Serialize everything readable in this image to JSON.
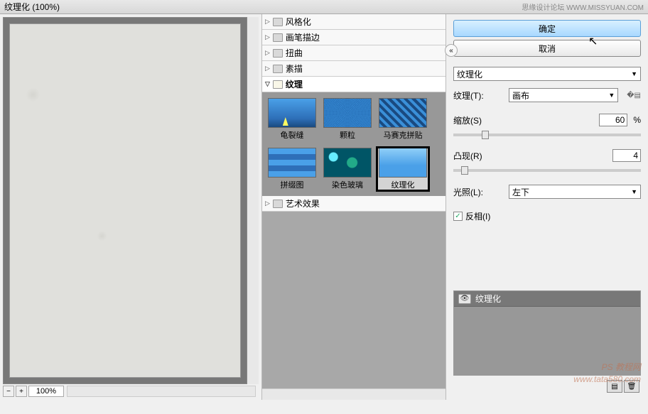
{
  "title": "纹理化 (100%)",
  "titlebar_right": "思缘设计论坛  WWW.MISSYUAN.COM",
  "zoom": "100%",
  "categories": [
    {
      "label": "风格化",
      "expanded": false
    },
    {
      "label": "画笔描边",
      "expanded": false
    },
    {
      "label": "扭曲",
      "expanded": false
    },
    {
      "label": "素描",
      "expanded": false
    },
    {
      "label": "纹理",
      "expanded": true
    },
    {
      "label": "艺术效果",
      "expanded": false
    }
  ],
  "thumbs": [
    {
      "label": "龟裂缝",
      "cls": "t-sky"
    },
    {
      "label": "颗粒",
      "cls": "t-grain"
    },
    {
      "label": "马赛克拼贴",
      "cls": "t-mosaic"
    },
    {
      "label": "拼缀图",
      "cls": "t-patch"
    },
    {
      "label": "染色玻璃",
      "cls": "t-stained"
    },
    {
      "label": "纹理化",
      "cls": "t-texture"
    }
  ],
  "selected_thumb": 5,
  "buttons": {
    "ok": "确定",
    "cancel": "取消"
  },
  "filter_select": "纹理化",
  "params": {
    "texture_label": "纹理(T):",
    "texture_value": "画布",
    "scale_label": "缩放(S)",
    "scale_value": "60",
    "scale_unit": "%",
    "relief_label": "凸现(R)",
    "relief_value": "4",
    "light_label": "光照(L):",
    "light_value": "左下",
    "invert_label": "反相(I)",
    "invert_checked": true
  },
  "effect_layer": "纹理化",
  "watermark_lines": [
    "PS 教程网",
    "www.tata580.com"
  ]
}
